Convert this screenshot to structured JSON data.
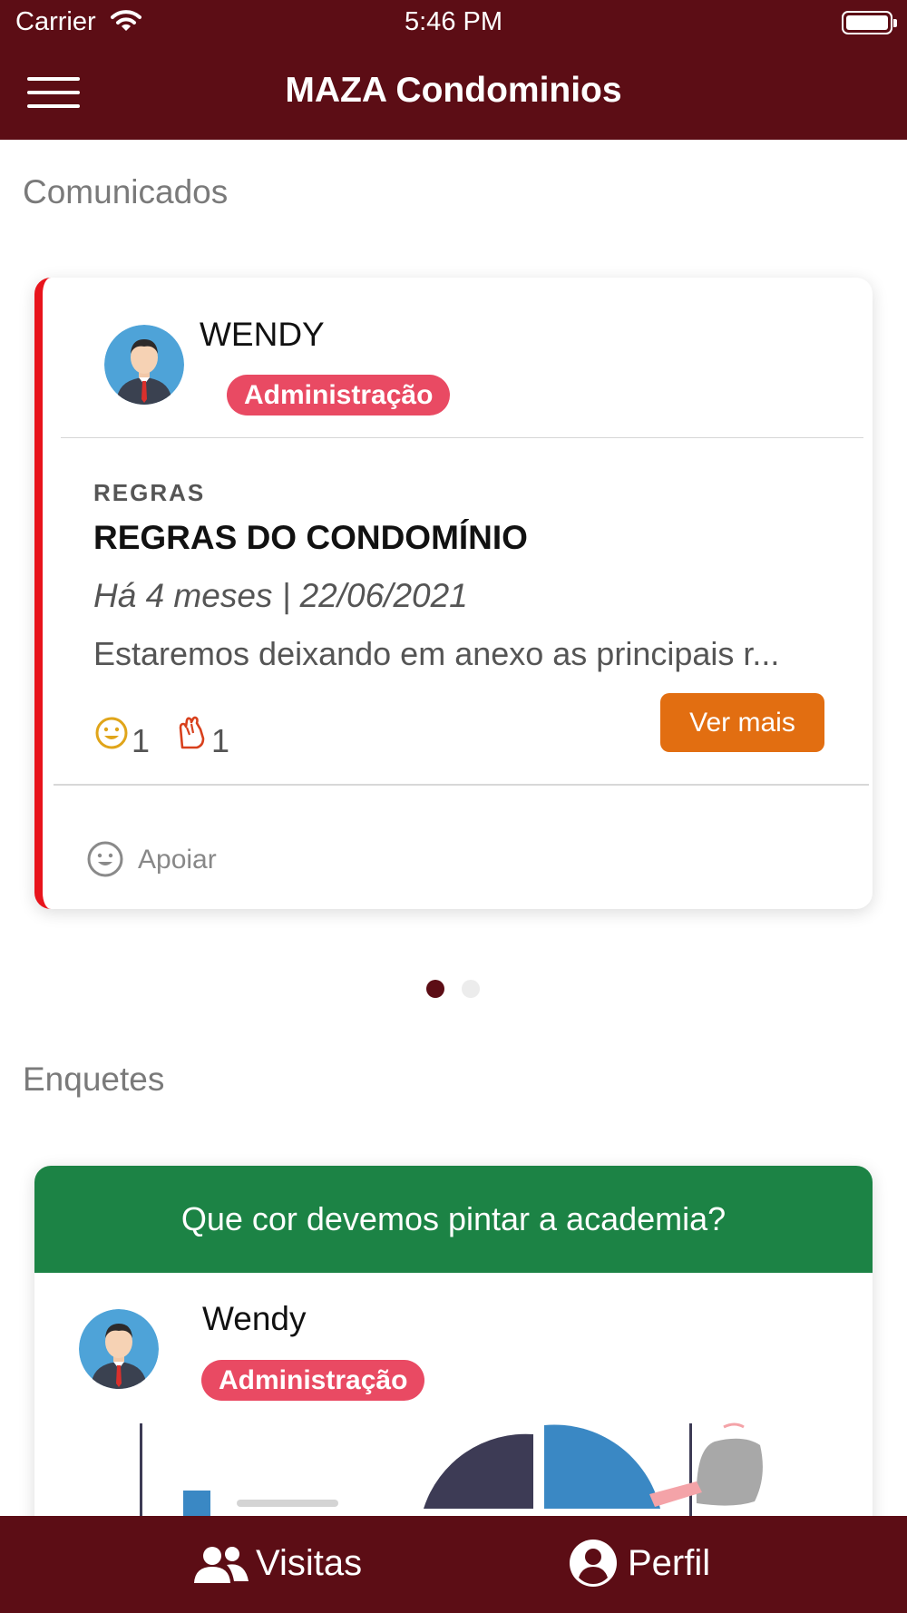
{
  "status_bar": {
    "carrier": "Carrier",
    "time": "5:46 PM"
  },
  "nav": {
    "title": "MAZA Condominios"
  },
  "sections": {
    "announcements": "Comunicados",
    "polls": "Enquetes"
  },
  "announcement": {
    "author": "WENDY",
    "badge": "Administração",
    "category": "REGRAS",
    "title": "REGRAS DO CONDOMÍNIO",
    "date": "Há 4 meses | 22/06/2021",
    "excerpt": "Estaremos deixando em anexo as principais r...",
    "reactions": [
      {
        "icon": "smiley-icon",
        "count": "1"
      },
      {
        "icon": "clap-icon",
        "count": "1"
      }
    ],
    "more_button": "Ver mais",
    "support_label": "Apoiar"
  },
  "carousel": {
    "pages": 2,
    "active": 0
  },
  "poll": {
    "question": "Que cor devemos pintar a academia?",
    "author": "Wendy",
    "badge": "Administração"
  },
  "tabs": [
    {
      "label": "Visitas",
      "icon": "users-icon"
    },
    {
      "label": "Perfil",
      "icon": "profile-icon"
    }
  ],
  "colors": {
    "brand": "#5c0d15",
    "badge": "#e94a63",
    "accent_button": "#e26e11",
    "poll_header": "#1c8345",
    "card_stripe": "#e8141c"
  }
}
